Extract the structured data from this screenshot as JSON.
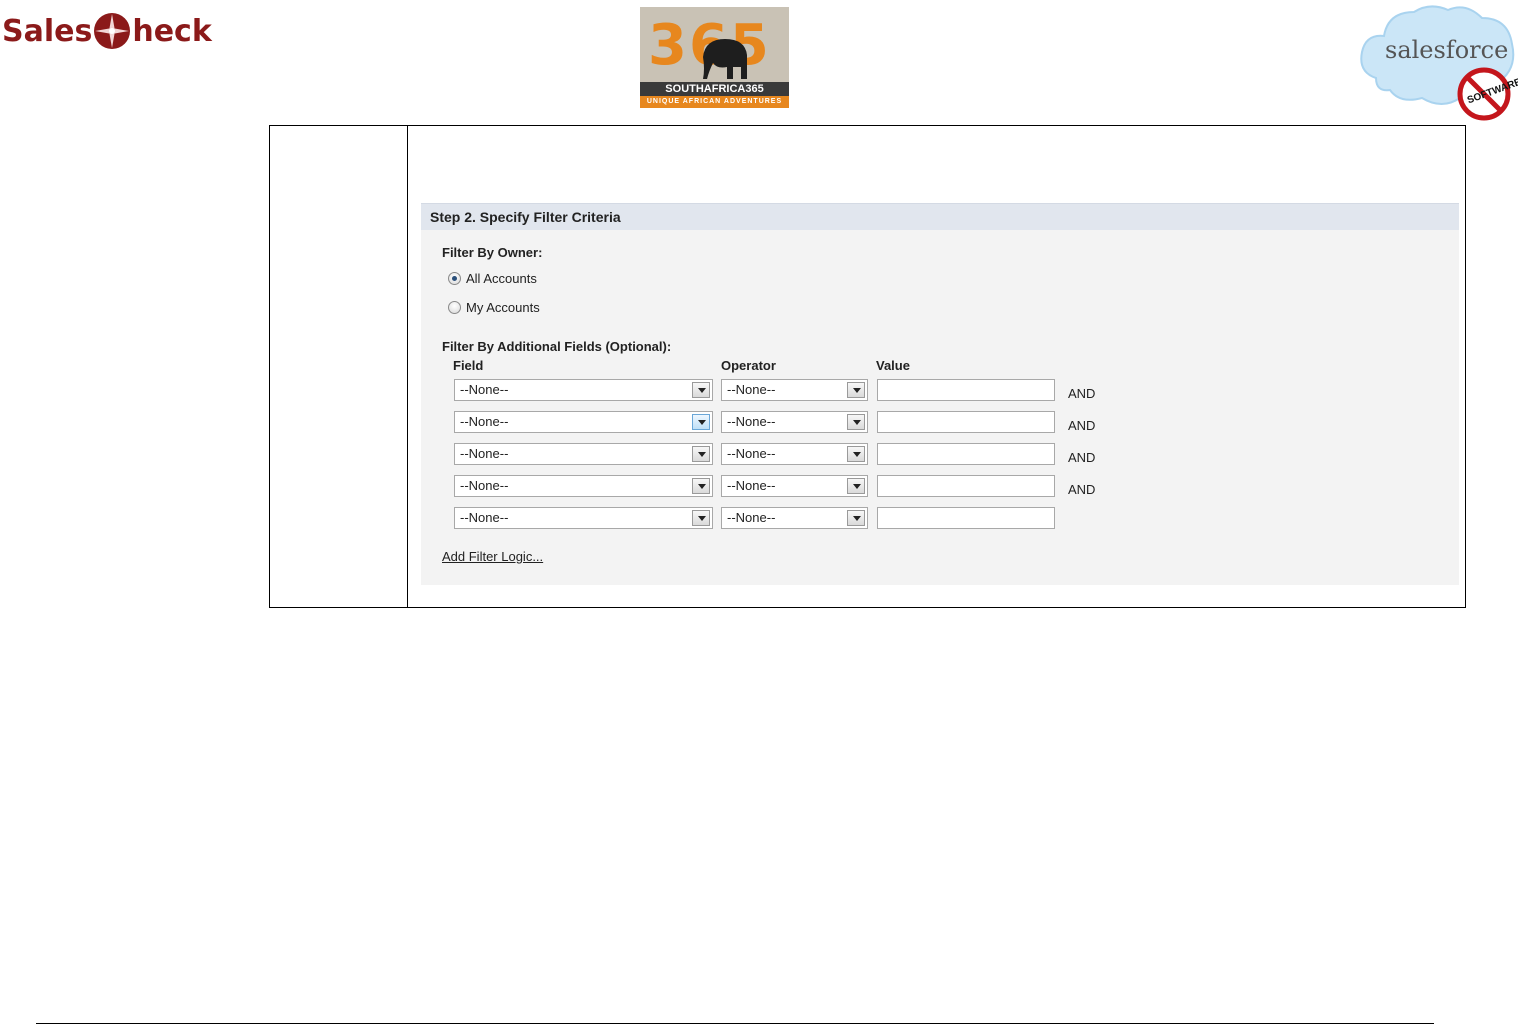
{
  "header": {
    "salescheck_logo": {
      "part1": "Sales",
      "part2": "heck"
    },
    "sa365_logo": {
      "number": "365",
      "name": "SOUTHAFRICA365",
      "tagline": "UNIQUE AFRICAN ADVENTURES"
    },
    "salesforce_logo": {
      "text": "salesforce",
      "badge": "SOFTWARE"
    }
  },
  "panel": {
    "title": "Step 2. Specify Filter Criteria",
    "filter_by_owner_label": "Filter By Owner:",
    "owner_options": [
      {
        "label": "All Accounts",
        "checked": true
      },
      {
        "label": "My Accounts",
        "checked": false
      }
    ],
    "additional_fields_label": "Filter By Additional Fields (Optional):",
    "columns": {
      "field": "Field",
      "operator": "Operator",
      "value": "Value"
    },
    "rows": [
      {
        "field": "--None--",
        "operator": "--None--",
        "value": "",
        "conjunction": "AND"
      },
      {
        "field": "--None--",
        "operator": "--None--",
        "value": "",
        "conjunction": "AND"
      },
      {
        "field": "--None--",
        "operator": "--None--",
        "value": "",
        "conjunction": "AND"
      },
      {
        "field": "--None--",
        "operator": "--None--",
        "value": "",
        "conjunction": "AND"
      },
      {
        "field": "--None--",
        "operator": "--None--",
        "value": "",
        "conjunction": ""
      }
    ],
    "add_filter_logic": "Add Filter Logic..."
  }
}
